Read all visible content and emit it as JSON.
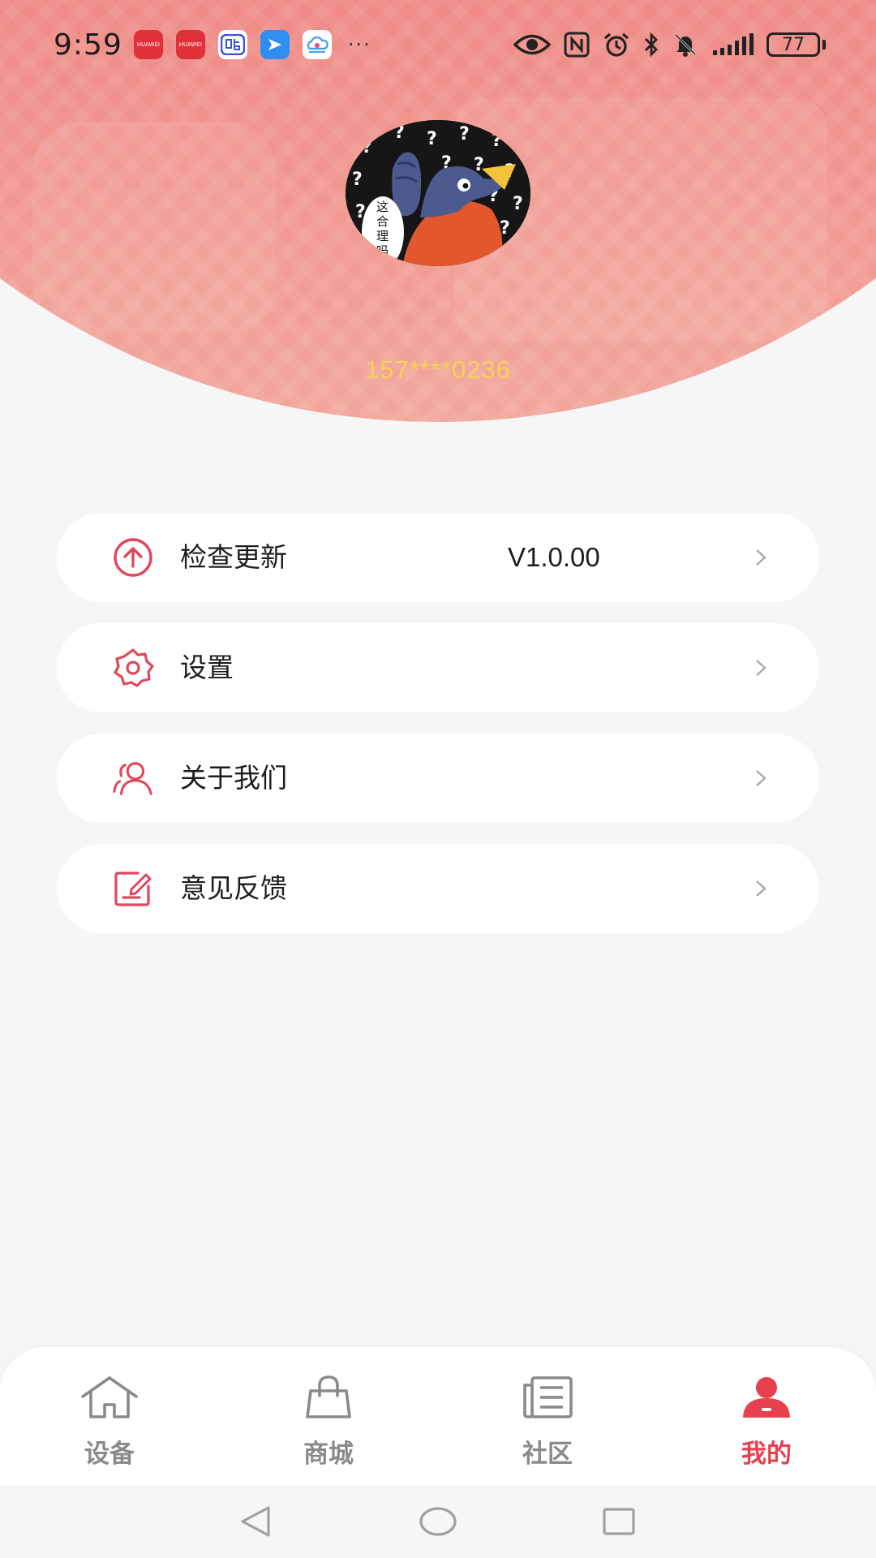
{
  "status_bar": {
    "time": "9:59",
    "notification_icons": [
      "huawei-store-icon",
      "huawei-store-icon",
      "tieba-icon",
      "arrow-app-icon",
      "cloud-app-icon"
    ],
    "more_indicator": "···",
    "system_icons": [
      "eye-icon",
      "nfc-icon",
      "alarm-icon",
      "bluetooth-icon",
      "mute-icon",
      "signal-icon",
      "battery-icon"
    ],
    "battery_level": "77"
  },
  "profile": {
    "avatar_label": "这合理吗",
    "phone": "157****0236"
  },
  "menu": {
    "items": [
      {
        "label": "检查更新",
        "value": "V1.0.00",
        "icon": "upload-circle-icon"
      },
      {
        "label": "设置",
        "icon": "gear-icon"
      },
      {
        "label": "关于我们",
        "icon": "users-icon"
      },
      {
        "label": "意见反馈",
        "icon": "feedback-edit-icon"
      }
    ]
  },
  "tabbar": {
    "tabs": [
      {
        "label": "设备",
        "icon": "home-icon",
        "active": false
      },
      {
        "label": "商城",
        "icon": "shopping-bag-icon",
        "active": false
      },
      {
        "label": "社区",
        "icon": "news-icon",
        "active": false
      },
      {
        "label": "我的",
        "icon": "person-icon",
        "active": true
      }
    ]
  },
  "colors": {
    "accent": "#e8404f",
    "header_top": "#e44c5e",
    "phone_text": "#f6d256",
    "inactive_tab": "#8a8a8a",
    "background": "#f6f6f6"
  }
}
